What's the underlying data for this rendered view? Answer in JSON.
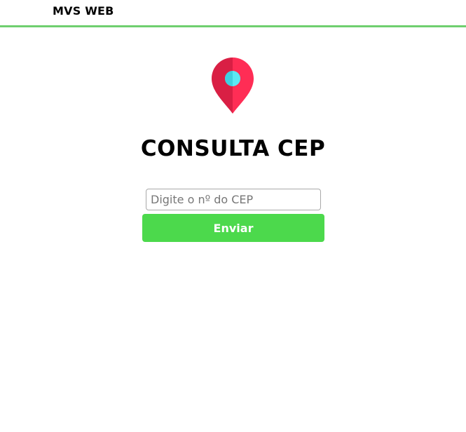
{
  "navbar": {
    "brand": "MVS WEB",
    "border_color": "#6fcf6f"
  },
  "hero": {
    "icon": "map-pin-icon",
    "icon_colors": {
      "pin_light": "#ff2d55",
      "pin_dark": "#d91f44",
      "dot": "#5ce8f4"
    },
    "title": "CONSULTA CEP"
  },
  "form": {
    "cep_input": {
      "value": "",
      "placeholder": "Digite o nº do CEP"
    },
    "submit_label": "Enviar",
    "submit_color": "#4cd94c"
  }
}
